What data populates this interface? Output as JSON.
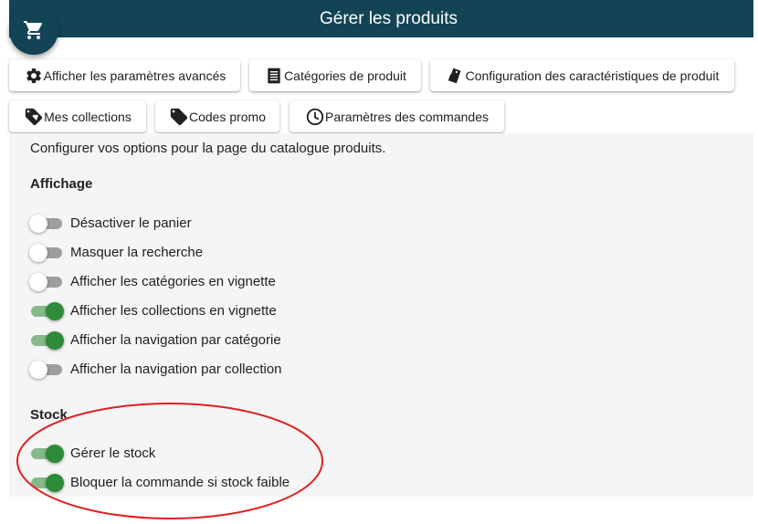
{
  "header": {
    "title": "Gérer les produits",
    "cart_icon": "cart-icon"
  },
  "buttons": [
    {
      "label": "Afficher les paramètres avancés",
      "icon": "gear-icon"
    },
    {
      "label": "Catégories de produit",
      "icon": "list-icon"
    },
    {
      "label": "Configuration des caractéristiques de produit",
      "icon": "tags-icon"
    },
    {
      "label": "Mes collections",
      "icon": "tag-heart-icon"
    },
    {
      "label": "Codes promo",
      "icon": "tag-icon"
    },
    {
      "label": "Paramètres des commandes",
      "icon": "clock-icon"
    }
  ],
  "intro": "Configurer vos options pour la page du catalogue produits.",
  "affichage": {
    "title": "Affichage",
    "options": [
      {
        "label": "Désactiver le panier",
        "on": false
      },
      {
        "label": "Masquer la recherche",
        "on": false
      },
      {
        "label": "Afficher les catégories en vignette",
        "on": false
      },
      {
        "label": "Afficher les collections en vignette",
        "on": true
      },
      {
        "label": "Afficher la navigation par catégorie",
        "on": true
      },
      {
        "label": "Afficher la navigation par collection",
        "on": false
      }
    ]
  },
  "stock": {
    "title": "Stock",
    "options": [
      {
        "label": "Gérer le stock",
        "on": true
      },
      {
        "label": "Bloquer la commande si stock faible",
        "on": true
      }
    ]
  },
  "colors": {
    "header": "#124456",
    "toggle_on": "#2e8b3a",
    "highlight": "#e02020"
  }
}
